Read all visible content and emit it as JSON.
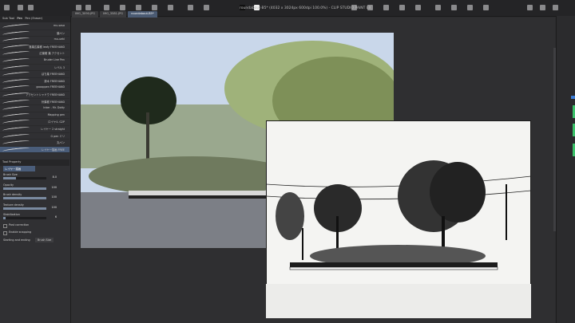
{
  "window": {
    "title": "roundabout-B5* (4032 x 3024px 600dpi 100.0%) - CLIP STUDIO PAINT EX"
  },
  "doc_tabs": [
    {
      "label": "IMG_3090.JPG",
      "active": false
    },
    {
      "label": "IMG_3581.JPG",
      "active": false
    },
    {
      "label": "roundabout-B5*",
      "active": true
    }
  ],
  "sub_tool": {
    "header": "Sub Tool",
    "group_tab": "Pen",
    "group_tab_2": "Pen (Eraser)",
    "brushes": [
      {
        "name": "mu-sasa"
      },
      {
        "name": "葉ペン"
      },
      {
        "name": "mu-ueki"
      },
      {
        "name": "落葉広葉樹 leafy FREEHAND"
      },
      {
        "name": "広葉樹 葉 アクセント"
      },
      {
        "name": "Bruder Line Pen"
      },
      {
        "name": "レベル 3"
      },
      {
        "name": "ぼち葉 FREEHAND"
      },
      {
        "name": "灌木 FREEHAND"
      },
      {
        "name": "goooppen FREEHAND"
      },
      {
        "name": "アクセントシャドウ FREEHAND"
      },
      {
        "name": "針葉樹 FREEHAND"
      },
      {
        "name": "Inker - Mr. Dotty"
      },
      {
        "name": "Mapping pen"
      },
      {
        "name": "ロイヤル G2P"
      },
      {
        "name": "レイヤー 2 straight"
      },
      {
        "name": "G pen ミリ"
      },
      {
        "name": "丸ペン"
      },
      {
        "name": "レイヤー描画 FREE",
        "selected": true
      }
    ]
  },
  "tool_property": {
    "header": "Tool Property",
    "tool_name": "レイヤー描画",
    "brush_size_label": "Brush Size",
    "brush_size_value": "8.0",
    "opacity_label": "Opacity",
    "opacity_value": "100",
    "brush_density_label": "Brush density",
    "brush_density_value": "100",
    "texture_density_label": "Texture density",
    "texture_density_value": "100",
    "stabilization_label": "Stabilization",
    "stabilization_value": "6",
    "post_correction_label": "Post correction",
    "enable_snapping_label": "Enable snapping",
    "starting_ending_label": "Starting and ending",
    "starting_ending_value": "Brush Size"
  },
  "colors": {
    "accent": "#4a5d7a",
    "sky": "#c7d5e8",
    "ground": "#7f8289",
    "green_swatch": "#3cc26a"
  }
}
